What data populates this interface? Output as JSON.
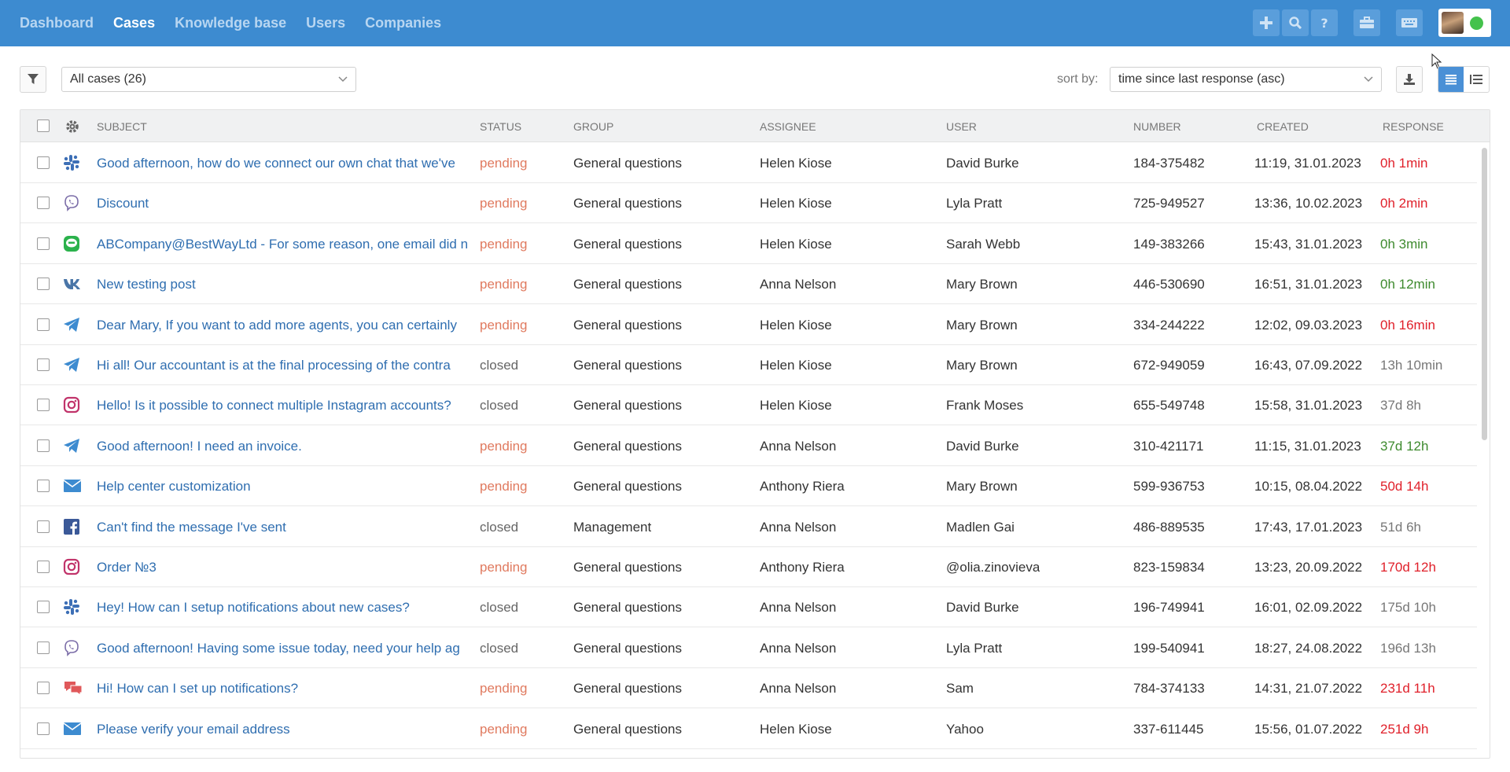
{
  "nav": {
    "items": [
      {
        "label": "Dashboard",
        "active": false
      },
      {
        "label": "Cases",
        "active": true
      },
      {
        "label": "Knowledge base",
        "active": false
      },
      {
        "label": "Users",
        "active": false
      },
      {
        "label": "Companies",
        "active": false
      }
    ]
  },
  "toolbar": {
    "case_filter_value": "All cases (26)",
    "sort_label": "sort by:",
    "sort_value": "time since last response (asc)"
  },
  "table": {
    "columns": [
      "SUBJECT",
      "STATUS",
      "GROUP",
      "ASSIGNEE",
      "USER",
      "NUMBER",
      "CREATED",
      "RESPONSE"
    ],
    "rows": [
      {
        "channel": "slack-icon",
        "subject": "Good afternoon, how do we connect our own chat that we've",
        "status": "pending",
        "group": "General questions",
        "assignee": "Helen Kiose",
        "user": "David Burke",
        "number": "184-375482",
        "created": "11:19, 31.01.2023",
        "response": "0h 1min",
        "response_color": "#e0202a"
      },
      {
        "channel": "viber-icon",
        "subject": "Discount",
        "status": "pending",
        "group": "General questions",
        "assignee": "Helen Kiose",
        "user": "Lyla Pratt",
        "number": "725-949527",
        "created": "13:36, 10.02.2023",
        "response": "0h 2min",
        "response_color": "#e0202a"
      },
      {
        "channel": "line-icon",
        "subject": "ABCompany@BestWayLtd - For some reason, one email did n",
        "status": "pending",
        "group": "General questions",
        "assignee": "Helen Kiose",
        "user": "Sarah Webb",
        "number": "149-383266",
        "created": "15:43, 31.01.2023",
        "response": "0h 3min",
        "response_color": "#3e8a2e"
      },
      {
        "channel": "vk-icon",
        "subject": "New testing post",
        "status": "pending",
        "group": "General questions",
        "assignee": "Anna Nelson",
        "user": "Mary Brown",
        "number": "446-530690",
        "created": "16:51, 31.01.2023",
        "response": "0h 12min",
        "response_color": "#3e8a2e"
      },
      {
        "channel": "telegram-icon",
        "subject": "Dear Mary, If you want to add more agents, you can certainly",
        "status": "pending",
        "group": "General questions",
        "assignee": "Helen Kiose",
        "user": "Mary Brown",
        "number": "334-244222",
        "created": "12:02, 09.03.2023",
        "response": "0h 16min",
        "response_color": "#e0202a"
      },
      {
        "channel": "telegram-icon",
        "subject": "Hi all! Our accountant is at the final processing of the contra",
        "status": "closed",
        "group": "General questions",
        "assignee": "Helen Kiose",
        "user": "Mary Brown",
        "number": "672-949059",
        "created": "16:43, 07.09.2022",
        "response": "13h 10min",
        "response_color": "#777777"
      },
      {
        "channel": "instagram-icon",
        "subject": "Hello! Is it possible to connect multiple Instagram accounts?",
        "status": "closed",
        "group": "General questions",
        "assignee": "Helen Kiose",
        "user": "Frank Moses",
        "number": "655-549748",
        "created": "15:58, 31.01.2023",
        "response": "37d 8h",
        "response_color": "#777777"
      },
      {
        "channel": "telegram-icon",
        "subject": "Good afternoon! I need an invoice.",
        "status": "pending",
        "group": "General questions",
        "assignee": "Anna Nelson",
        "user": "David Burke",
        "number": "310-421171",
        "created": "11:15, 31.01.2023",
        "response": "37d 12h",
        "response_color": "#3e8a2e"
      },
      {
        "channel": "email-icon",
        "subject": "Help center customization",
        "status": "pending",
        "group": "General questions",
        "assignee": "Anthony Riera",
        "user": "Mary Brown",
        "number": "599-936753",
        "created": "10:15, 08.04.2022",
        "response": "50d 14h",
        "response_color": "#e0202a"
      },
      {
        "channel": "facebook-icon",
        "subject": "Can't find the message I've sent",
        "status": "closed",
        "group": "Management",
        "assignee": "Anna Nelson",
        "user": "Madlen Gai",
        "number": "486-889535",
        "created": "17:43, 17.01.2023",
        "response": "51d 6h",
        "response_color": "#777777"
      },
      {
        "channel": "instagram-icon",
        "subject": "Order №3",
        "status": "pending",
        "group": "General questions",
        "assignee": "Anthony Riera",
        "user": "@olia.zinovieva",
        "number": "823-159834",
        "created": "13:23, 20.09.2022",
        "response": "170d 12h",
        "response_color": "#e0202a"
      },
      {
        "channel": "slack-icon",
        "subject": "Hey! How can I setup notifications about new cases?",
        "status": "closed",
        "group": "General questions",
        "assignee": "Anna Nelson",
        "user": "David Burke",
        "number": "196-749941",
        "created": "16:01, 02.09.2022",
        "response": "175d 10h",
        "response_color": "#777777"
      },
      {
        "channel": "viber-icon",
        "subject": "Good afternoon! Having some issue today, need your help ag",
        "status": "closed",
        "group": "General questions",
        "assignee": "Anna Nelson",
        "user": "Lyla Pratt",
        "number": "199-540941",
        "created": "18:27, 24.08.2022",
        "response": "196d 13h",
        "response_color": "#777777"
      },
      {
        "channel": "chat-icon",
        "subject": "Hi! How can I set up notifications?",
        "status": "pending",
        "group": "General questions",
        "assignee": "Anna Nelson",
        "user": "Sam",
        "number": "784-374133",
        "created": "14:31, 21.07.2022",
        "response": "231d 11h",
        "response_color": "#e0202a"
      },
      {
        "channel": "email-icon",
        "subject": "Please verify your email address",
        "status": "pending",
        "group": "General questions",
        "assignee": "Helen Kiose",
        "user": "Yahoo",
        "number": "337-611445",
        "created": "15:56, 01.07.2022",
        "response": "251d 9h",
        "response_color": "#e0202a"
      }
    ]
  },
  "icons": {
    "nav_tools": [
      "plus-icon",
      "search-icon",
      "help-icon",
      "briefcase-icon",
      "keyboard-icon"
    ],
    "filter": "filter-icon",
    "settings": "gear-icon",
    "download": "download-icon",
    "view_list": "list-view-icon",
    "view_compact": "compact-view-icon"
  },
  "colors": {
    "topbar": "#3d8bd0",
    "link": "#2f6eb0",
    "pending": "#e07a5f",
    "online": "#44c24c"
  }
}
